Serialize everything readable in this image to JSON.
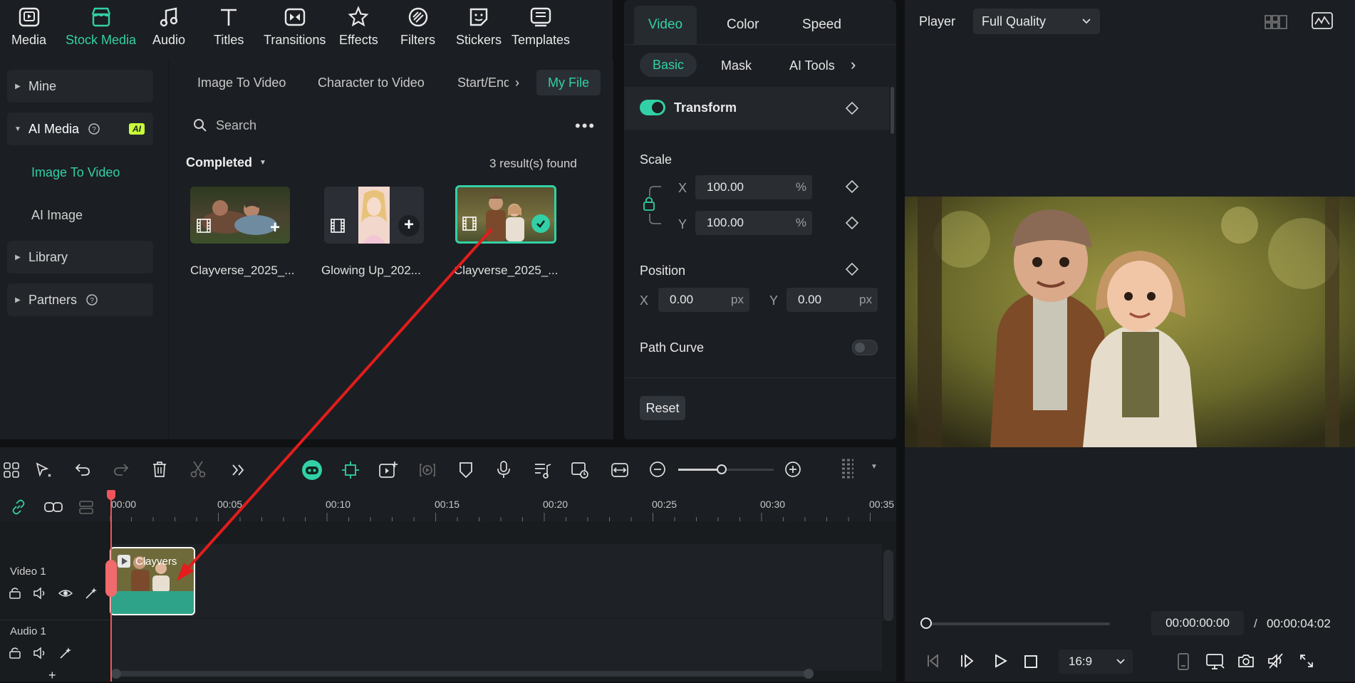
{
  "toolbar": {
    "items": [
      {
        "label": "Media",
        "icon": "media-icon"
      },
      {
        "label": "Stock Media",
        "icon": "stock-media-icon"
      },
      {
        "label": "Audio",
        "icon": "audio-icon"
      },
      {
        "label": "Titles",
        "icon": "titles-icon"
      },
      {
        "label": "Transitions",
        "icon": "transitions-icon"
      },
      {
        "label": "Effects",
        "icon": "effects-icon"
      },
      {
        "label": "Filters",
        "icon": "filters-icon"
      },
      {
        "label": "Stickers",
        "icon": "stickers-icon"
      },
      {
        "label": "Templates",
        "icon": "templates-icon"
      }
    ]
  },
  "sidebar": {
    "mine": "Mine",
    "ai_media": "AI Media",
    "ai_badge": "AI",
    "image_to_video": "Image To Video",
    "ai_image": "AI Image",
    "library": "Library",
    "partners": "Partners"
  },
  "media": {
    "tabs": [
      "Image To Video",
      "Character to Video",
      "Start/End I",
      "My File"
    ],
    "search_placeholder": "Search",
    "filter": "Completed",
    "results": "3 result(s) found",
    "files": [
      {
        "name": "Clayverse_2025_..."
      },
      {
        "name": "Glowing Up_202..."
      },
      {
        "name": "Clayverse_2025_..."
      }
    ]
  },
  "props": {
    "tabs": [
      "Video",
      "Color",
      "Speed"
    ],
    "subtabs": [
      "Basic",
      "Mask",
      "AI Tools"
    ],
    "transform": "Transform",
    "scale": "Scale",
    "scale_x_label": "X",
    "scale_x": "100.00",
    "scale_y_label": "Y",
    "scale_y": "100.00",
    "percent": "%",
    "position": "Position",
    "pos_x_label": "X",
    "pos_x": "0.00",
    "pos_y_label": "Y",
    "pos_y": "0.00",
    "px": "px",
    "path_curve": "Path Curve",
    "reset": "Reset"
  },
  "player": {
    "label": "Player",
    "quality": "Full Quality",
    "current_time": "00:00:00:00",
    "separator": "/",
    "total_time": "00:00:04:02",
    "aspect": "16:9"
  },
  "timeline": {
    "ticks": [
      "00:00",
      "00:05",
      "00:10",
      "00:15",
      "00:20",
      "00:25",
      "00:30",
      "00:35"
    ],
    "video_track": "Video 1",
    "audio_track": "Audio 1",
    "clip_name": "Clayvers",
    "add": "+"
  },
  "colors": {
    "accent": "#32d0a6",
    "arrow": "#e31c1c",
    "playhead": "#f0555a"
  }
}
